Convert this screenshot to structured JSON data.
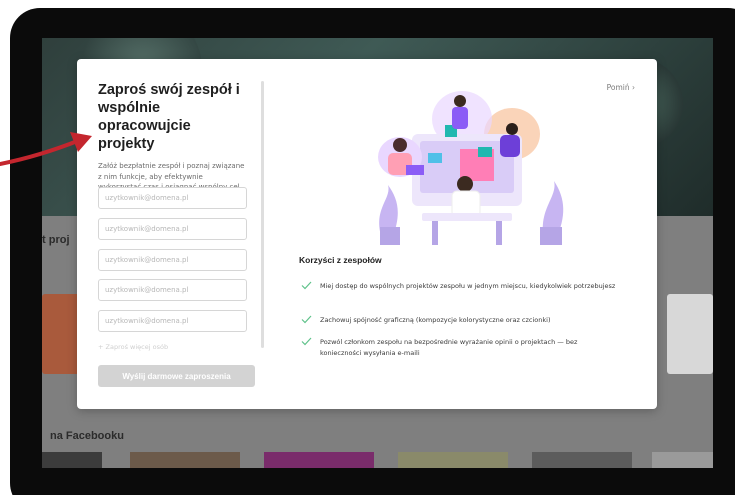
{
  "background": {
    "section_title_1": "t proj",
    "section_title_2": "na Facebooku"
  },
  "modal": {
    "title": "Zaproś swój zespół i wspólnie opracowujcie projekty",
    "description": "Załóż bezpłatnie zespół i poznaj związane z nim funkcje, aby efektywnie wykorzystać czas i osiągnąć wspólny cel.",
    "email_placeholder": "uzytkownik@domena.pl",
    "add_more_link": "+ Zaproś więcej osób",
    "send_button": "Wyślij darmowe zaproszenia",
    "skip_link": "Pomiń ›",
    "benefits_title": "Korzyści z zespołów",
    "benefits": [
      "Miej dostęp do wspólnych projektów zespołu w jednym miejscu, kiedykolwiek potrzebujesz",
      "Zachowuj spójność graficzną (kompozycje kolorystyczne oraz czcionki)",
      "Pozwól członkom zespołu na bezpośrednie wyrażanie opinii o projektach — bez konieczności wysyłania e-maili"
    ]
  },
  "colors": {
    "accent_check": "#5ec28a",
    "arrow": "#c4262e",
    "illustration_purple": "#8b5cf6"
  }
}
